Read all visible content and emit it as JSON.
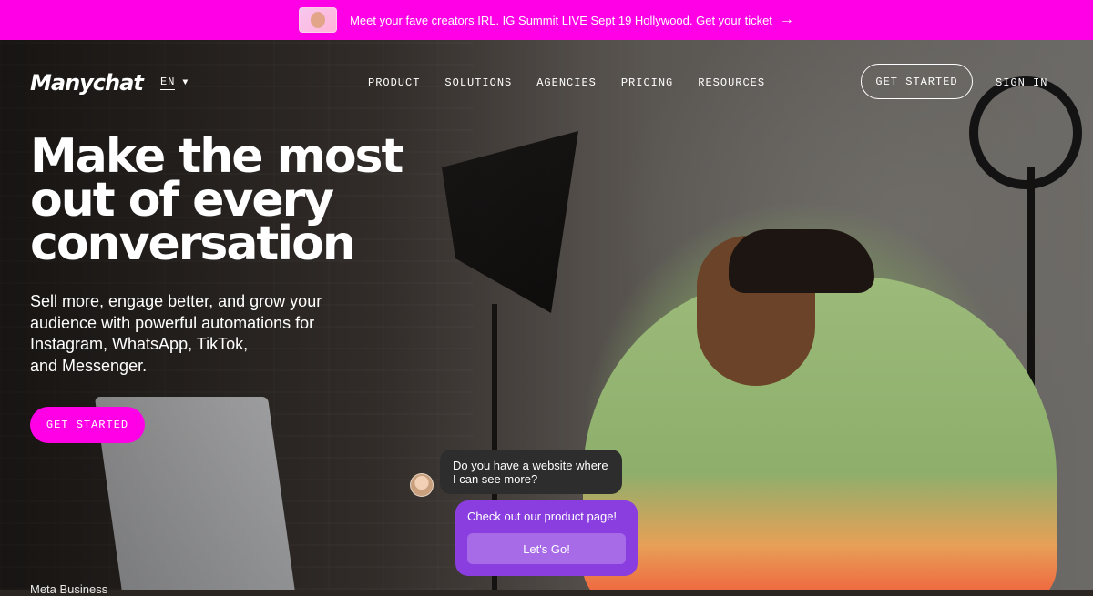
{
  "banner": {
    "text": "Meet your fave creators IRL. IG Summit LIVE Sept 19 Hollywood. Get your ticket",
    "arrow_icon": "arrow-right-icon",
    "background": "#ff00e6"
  },
  "nav": {
    "logo": "Manychat",
    "language": "EN",
    "items": [
      "PRODUCT",
      "SOLUTIONS",
      "AGENCIES",
      "PRICING",
      "RESOURCES"
    ],
    "get_started": "GET STARTED",
    "sign_in": "SIGN IN"
  },
  "hero": {
    "headline_lines": [
      "Make the most",
      "out of every",
      "conversation"
    ],
    "subhead_lines": [
      "Sell more, engage better, and grow your",
      "audience with powerful automations for",
      "Instagram, WhatsApp, TikTok,",
      "and Messenger."
    ],
    "cta": "GET STARTED",
    "accent_color": "#ff00e6"
  },
  "chat": {
    "question": "Do you have a website where I can see more?",
    "answer": "Check out our product page!",
    "button": "Let's Go!",
    "answer_color": "#8b3ee0"
  },
  "trust": {
    "items": [
      "Meta Business",
      "",
      ""
    ]
  }
}
